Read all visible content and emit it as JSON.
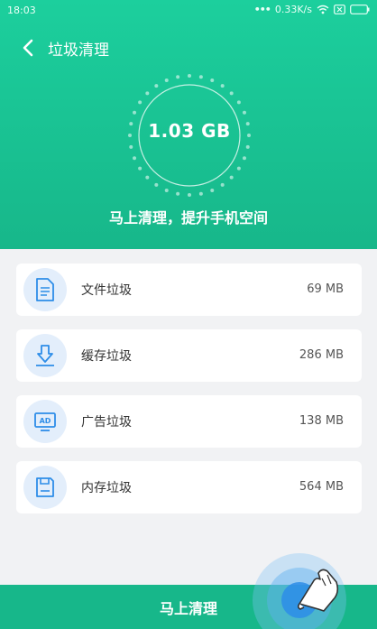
{
  "status": {
    "time": "18:03",
    "net_speed": "0.33K/s"
  },
  "header": {
    "title": "垃圾清理",
    "total_size": "1.03 GB",
    "subtitle": "马上清理，提升手机空间"
  },
  "items": [
    {
      "icon": "document-icon",
      "label": "文件垃圾",
      "size": "69 MB"
    },
    {
      "icon": "download-icon",
      "label": "缓存垃圾",
      "size": "286 MB"
    },
    {
      "icon": "ad-icon",
      "label": "广告垃圾",
      "size": "138 MB"
    },
    {
      "icon": "save-icon",
      "label": "内存垃圾",
      "size": "564 MB"
    }
  ],
  "footer": {
    "button_label": "马上清理"
  },
  "colors": {
    "accent": "#17b78a",
    "icon_blue": "#2d8de8"
  }
}
